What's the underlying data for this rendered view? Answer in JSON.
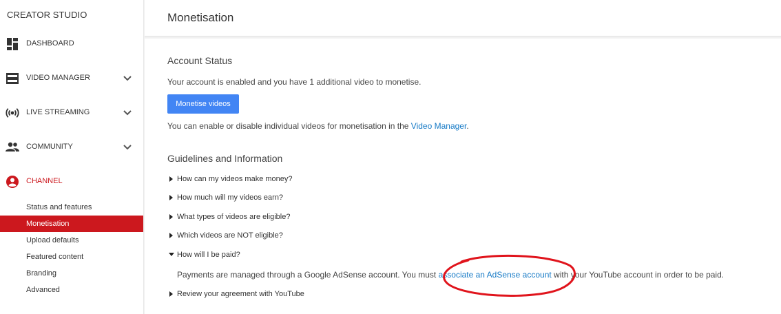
{
  "sidebar": {
    "app_title": "CREATOR STUDIO",
    "nav": [
      {
        "label": "DASHBOARD",
        "icon": "dashboard-icon"
      },
      {
        "label": "VIDEO MANAGER",
        "icon": "video-manager-icon"
      },
      {
        "label": "LIVE STREAMING",
        "icon": "live-streaming-icon"
      },
      {
        "label": "COMMUNITY",
        "icon": "community-icon"
      },
      {
        "label": "CHANNEL",
        "icon": "channel-icon"
      }
    ],
    "channel_items": [
      {
        "label": "Status and features"
      },
      {
        "label": "Monetisation"
      },
      {
        "label": "Upload defaults"
      },
      {
        "label": "Featured content"
      },
      {
        "label": "Branding"
      },
      {
        "label": "Advanced"
      }
    ],
    "active_section": "CHANNEL",
    "selected_item": "Monetisation"
  },
  "header": {
    "title": "Monetisation"
  },
  "account_status": {
    "heading": "Account Status",
    "status_text": "Your account is enabled and you have 1 additional video to monetise.",
    "button_label": "Monetise videos",
    "note_prefix": "You can enable or disable individual videos for monetisation in the ",
    "note_link": "Video Manager",
    "note_suffix": "."
  },
  "guidelines": {
    "heading": "Guidelines and Information",
    "items": [
      {
        "question": "How can my videos make money?",
        "expanded": false
      },
      {
        "question": "How much will my videos earn?",
        "expanded": false
      },
      {
        "question": "What types of videos are eligible?",
        "expanded": false
      },
      {
        "question": "Which videos are NOT eligible?",
        "expanded": false
      },
      {
        "question": "How will I be paid?",
        "expanded": true
      },
      {
        "question": "Review your agreement with YouTube",
        "expanded": false
      }
    ],
    "answer": {
      "prefix": "Payments are managed through a Google AdSense account. You must ",
      "link": "associate an AdSense account",
      "suffix": " with your YouTube account in order to be paid."
    }
  },
  "colors": {
    "accent_red": "#cc181e",
    "link_blue": "#167ac6",
    "button_blue": "#4285f4",
    "annotation_red": "#e0141c"
  }
}
